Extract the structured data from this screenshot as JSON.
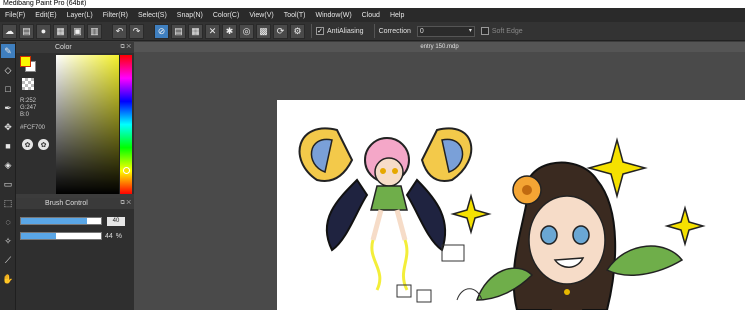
{
  "window": {
    "title": "Medibang Paint Pro (64bit)"
  },
  "menu": [
    "File(F)",
    "Edit(E)",
    "Layer(L)",
    "Filter(R)",
    "Select(S)",
    "Snap(N)",
    "Color(C)",
    "View(V)",
    "Tool(T)",
    "Window(W)",
    "Cloud",
    "Help"
  ],
  "toolbar": {
    "antialiasing_label": "AntiAliasing",
    "antialiasing_checked": true,
    "correction_label": "Correction",
    "correction_value": "0",
    "soft_edge_label": "Soft Edge",
    "soft_edge_checked": false
  },
  "color_panel": {
    "title": "Color",
    "r": "R:252",
    "g": "G:247",
    "b": "B:0",
    "hex": "#FCF700",
    "fg_color": "#FCF700",
    "bg_color": "#FFFFFF"
  },
  "brush_control": {
    "title": "Brush Control",
    "size_value": "40",
    "size_fraction": 0.82,
    "opacity_value": "44",
    "opacity_unit": "%",
    "opacity_fraction": 0.44
  },
  "document": {
    "tab_title": "entry 150.mdp"
  }
}
